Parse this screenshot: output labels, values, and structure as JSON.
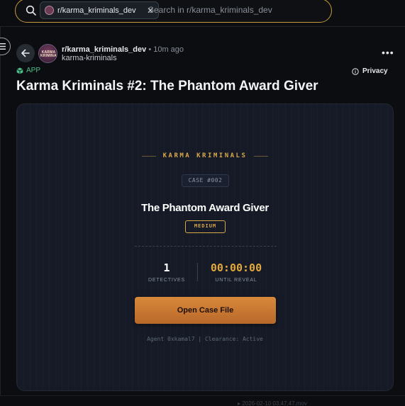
{
  "search": {
    "community_chip": "r/karma_kriminals_dev",
    "placeholder": "Search in r/karma_kriminals_dev"
  },
  "post": {
    "subreddit": "r/karma_kriminals_dev",
    "time": "• 10m ago",
    "author": "karma-kriminals",
    "avatar_text": "KARMA KRIMINALS",
    "app_tag": "APP",
    "privacy_label": "Privacy",
    "title": "Karma Kriminals #2: The Phantom Award Giver",
    "more_label": "•••"
  },
  "card": {
    "brand": "KARMA KRIMINALS",
    "case_number": "CASE #002",
    "case_title": "The Phantom Award Giver",
    "difficulty": "MEDIUM",
    "stats": {
      "detectives_value": "1",
      "detectives_label": "DETECTIVES",
      "timer_value": "00:00:00",
      "timer_label": "UNTIL REVEAL"
    },
    "open_button": "Open Case File",
    "agent_line": "Agent 0xkamal7 | Clearance: Active"
  },
  "footer": {
    "ghost_text": "▸ 2026-02-10 03.47.47.mov"
  },
  "colors": {
    "accent_gold": "#d9a84a",
    "button_orange": "#d9893a",
    "app_green": "#4fbf8a",
    "card_bg": "#151a26"
  }
}
